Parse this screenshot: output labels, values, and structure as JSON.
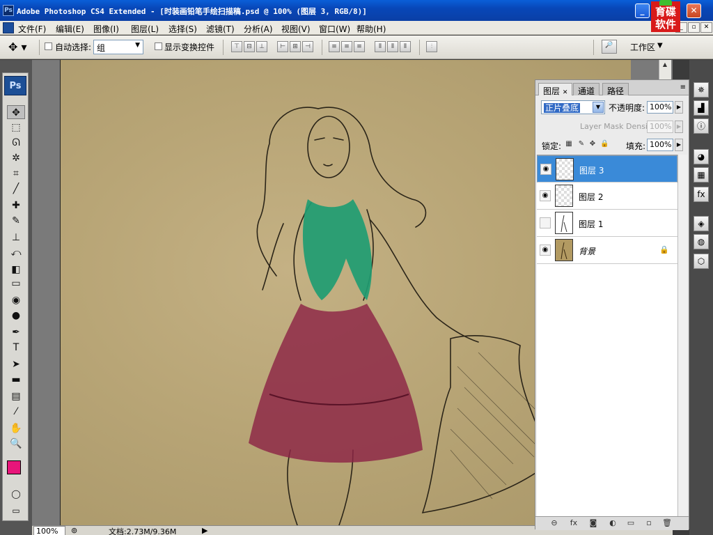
{
  "window": {
    "title": "Adobe Photoshop CS4 Extended - [时装画铅笔手绘扫描稿.psd @ 100% (图层 3, RGB/8)]",
    "logo_text": "育碟软件",
    "min": "_",
    "restore": "▫",
    "close": "✕"
  },
  "menu": [
    "文件(F)",
    "编辑(E)",
    "图像(I)",
    "图层(L)",
    "选择(S)",
    "滤镜(T)",
    "分析(A)",
    "视图(V)",
    "窗口(W)",
    "帮助(H)"
  ],
  "options": {
    "auto_select_label": "自动选择:",
    "auto_select_value": "组",
    "show_transform_label": "显示变换控件",
    "workspace_label": "工作区"
  },
  "tools": [
    {
      "icon": "move-icon",
      "glyph": "✥"
    },
    {
      "icon": "marquee-icon",
      "glyph": "⬚"
    },
    {
      "icon": "lasso-icon",
      "glyph": "ᘏ"
    },
    {
      "icon": "magic-wand-icon",
      "glyph": "✲"
    },
    {
      "icon": "crop-icon",
      "glyph": "⌗"
    },
    {
      "icon": "eyedropper-icon",
      "glyph": "╱"
    },
    {
      "icon": "healing-brush-icon",
      "glyph": "✚"
    },
    {
      "icon": "brush-icon",
      "glyph": "✎"
    },
    {
      "icon": "clone-stamp-icon",
      "glyph": "⊥"
    },
    {
      "icon": "history-brush-icon",
      "glyph": "⤺"
    },
    {
      "icon": "eraser-icon",
      "glyph": "◧"
    },
    {
      "icon": "gradient-icon",
      "glyph": "▭"
    },
    {
      "icon": "blur-icon",
      "glyph": "◉"
    },
    {
      "icon": "dodge-icon",
      "glyph": "●"
    },
    {
      "icon": "pen-icon",
      "glyph": "✒"
    },
    {
      "icon": "type-icon",
      "glyph": "T"
    },
    {
      "icon": "path-selection-icon",
      "glyph": "➤"
    },
    {
      "icon": "rectangle-icon",
      "glyph": "▬"
    },
    {
      "icon": "notes-icon",
      "glyph": "▤"
    },
    {
      "icon": "color-sampler-icon",
      "glyph": "⁄"
    },
    {
      "icon": "hand-icon",
      "glyph": "✋"
    },
    {
      "icon": "zoom-icon",
      "glyph": "🔍"
    }
  ],
  "colors": {
    "foreground": "#e8157a",
    "background": "#ffffff",
    "accent": "#3a8ad8",
    "skirt": "#8c2545",
    "top": "#1f9c72"
  },
  "layers_panel": {
    "tabs": [
      "图层",
      "通道",
      "路径"
    ],
    "blend_mode": "正片叠底",
    "opacity_label": "不透明度:",
    "opacity_value": "100%",
    "mask_density_label": "Layer Mask Density",
    "mask_density_value": "100%",
    "lock_label": "锁定:",
    "fill_label": "填充:",
    "fill_value": "100%",
    "layers": [
      {
        "name": "图层 3",
        "visible": true,
        "selected": true,
        "locked": false,
        "thumb": "transparent"
      },
      {
        "name": "图层 2",
        "visible": true,
        "selected": false,
        "locked": false,
        "thumb": "transparent"
      },
      {
        "name": "图层 1",
        "visible": false,
        "selected": false,
        "locked": false,
        "thumb": "sketch"
      },
      {
        "name": "背景",
        "visible": true,
        "selected": false,
        "locked": true,
        "thumb": "background"
      }
    ]
  },
  "status": {
    "zoom": "100%",
    "doc": "文档:2.73M/9.36M"
  }
}
